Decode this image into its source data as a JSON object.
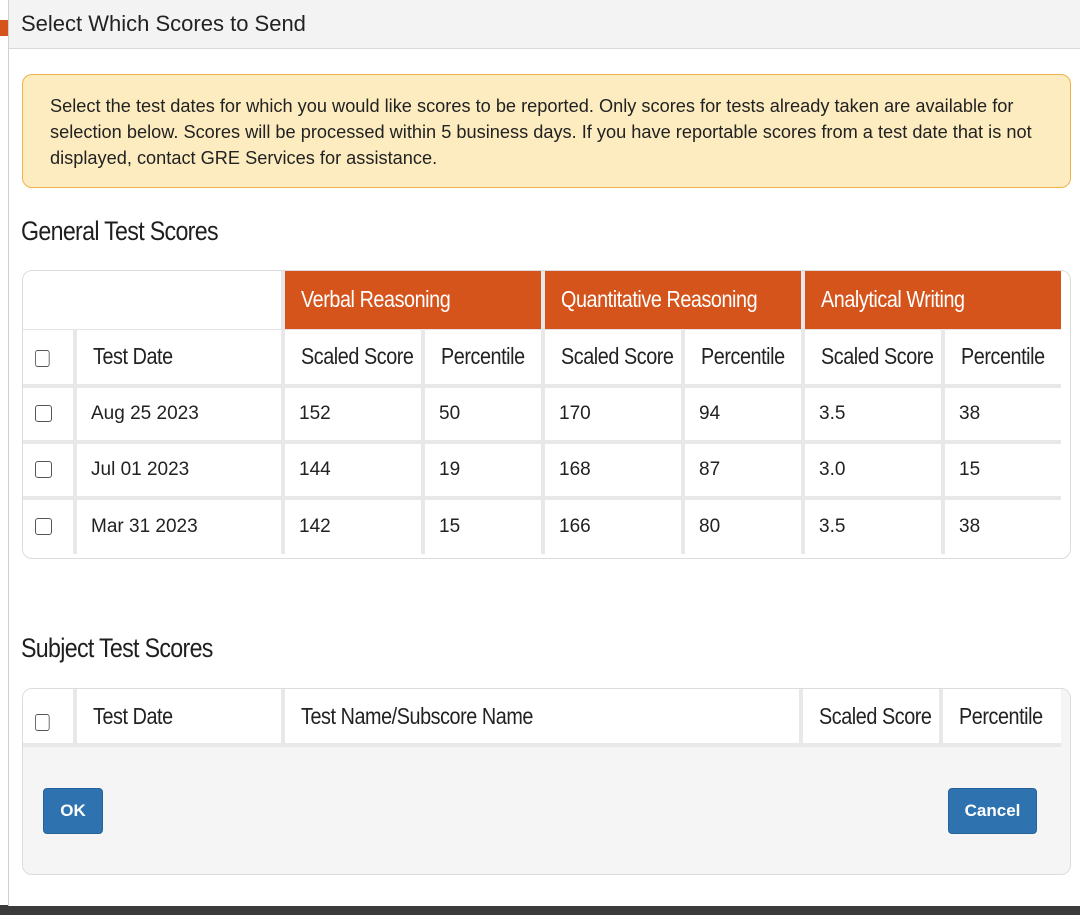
{
  "dialog": {
    "title": "Select Which Scores to Send"
  },
  "alert": {
    "text": "Select the test dates for which you would like scores to be reported. Only scores for tests already taken are available for selection below. Scores will be processed within 5 business days. If you have reportable scores from a test date that is not displayed, contact GRE Services for assistance."
  },
  "general": {
    "title": "General Test Scores",
    "groups": [
      "Verbal Reasoning",
      "Quantitative Reasoning",
      "Analytical Writing"
    ],
    "headers": {
      "test_date": "Test Date",
      "scaled": "Scaled Score",
      "percentile": "Percentile"
    },
    "rows": [
      {
        "date": "Aug 25 2023",
        "vs": "152",
        "vp": "50",
        "qs": "170",
        "qp": "94",
        "as": "3.5",
        "ap": "38"
      },
      {
        "date": "Jul 01 2023",
        "vs": "144",
        "vp": "19",
        "qs": "168",
        "qp": "87",
        "as": "3.0",
        "ap": "15"
      },
      {
        "date": "Mar 31 2023",
        "vs": "142",
        "vp": "15",
        "qs": "166",
        "qp": "80",
        "as": "3.5",
        "ap": "38"
      }
    ]
  },
  "subject": {
    "title": "Subject Test Scores",
    "headers": {
      "test_date": "Test Date",
      "test_name": "Test Name/Subscore Name",
      "scaled": "Scaled Score",
      "percentile": "Percentile"
    }
  },
  "buttons": {
    "ok": "OK",
    "cancel": "Cancel"
  },
  "colors": {
    "accent": "#d4541c",
    "alert_bg": "#fdecc0",
    "alert_border": "#f0b24b",
    "button": "#2e73b0"
  }
}
